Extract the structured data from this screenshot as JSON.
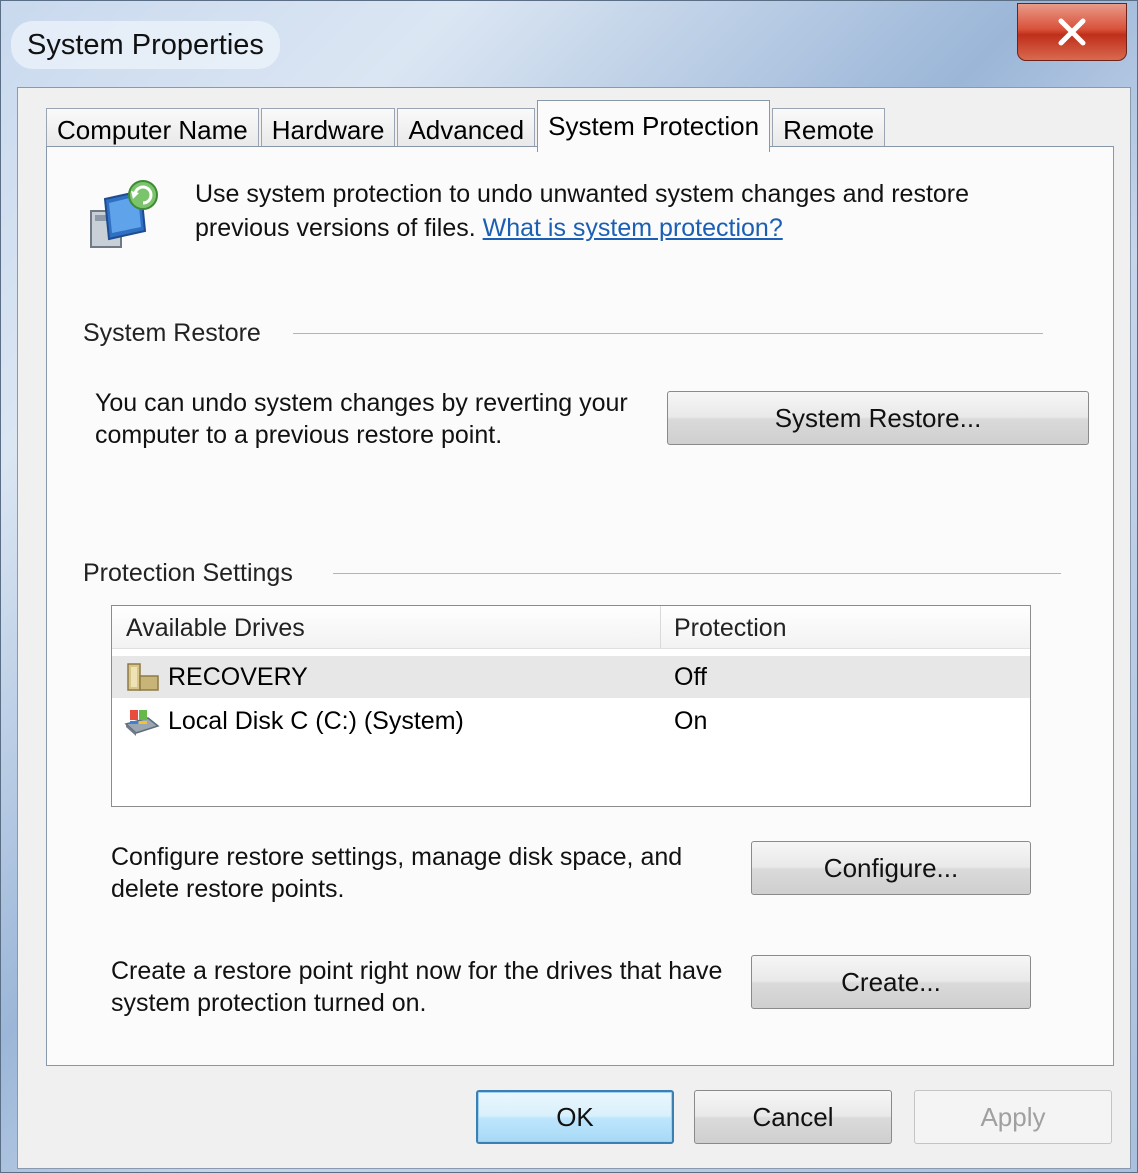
{
  "window": {
    "title": "System Properties",
    "close_label": "X"
  },
  "tabs": [
    {
      "label": "Computer Name"
    },
    {
      "label": "Hardware"
    },
    {
      "label": "Advanced"
    },
    {
      "label": "System Protection",
      "active": true
    },
    {
      "label": "Remote"
    }
  ],
  "intro": {
    "text": "Use system protection to undo unwanted system changes and restore previous versions of files. ",
    "link": "What is system protection?"
  },
  "system_restore": {
    "group_title": "System Restore",
    "description": "You can undo system changes by reverting your computer to a previous restore point.",
    "button_label": "System Restore..."
  },
  "protection_settings": {
    "group_title": "Protection Settings",
    "columns": [
      "Available Drives",
      "Protection"
    ],
    "drives": [
      {
        "name": "RECOVERY",
        "protection": "Off",
        "icon": "folder-drive-icon",
        "selected": true
      },
      {
        "name": "Local Disk C (C:) (System)",
        "protection": "On",
        "icon": "system-drive-icon",
        "selected": false
      }
    ],
    "configure_description": "Configure restore settings, manage disk space, and delete restore points.",
    "configure_button": "Configure...",
    "create_description": "Create a restore point right now for the drives that have system protection turned on.",
    "create_button": "Create..."
  },
  "dialog_buttons": {
    "ok": "OK",
    "cancel": "Cancel",
    "apply": "Apply"
  },
  "colors": {
    "link": "#1a5fb4",
    "close_button": "#c8402a",
    "default_button_border": "#3c7fb1"
  }
}
